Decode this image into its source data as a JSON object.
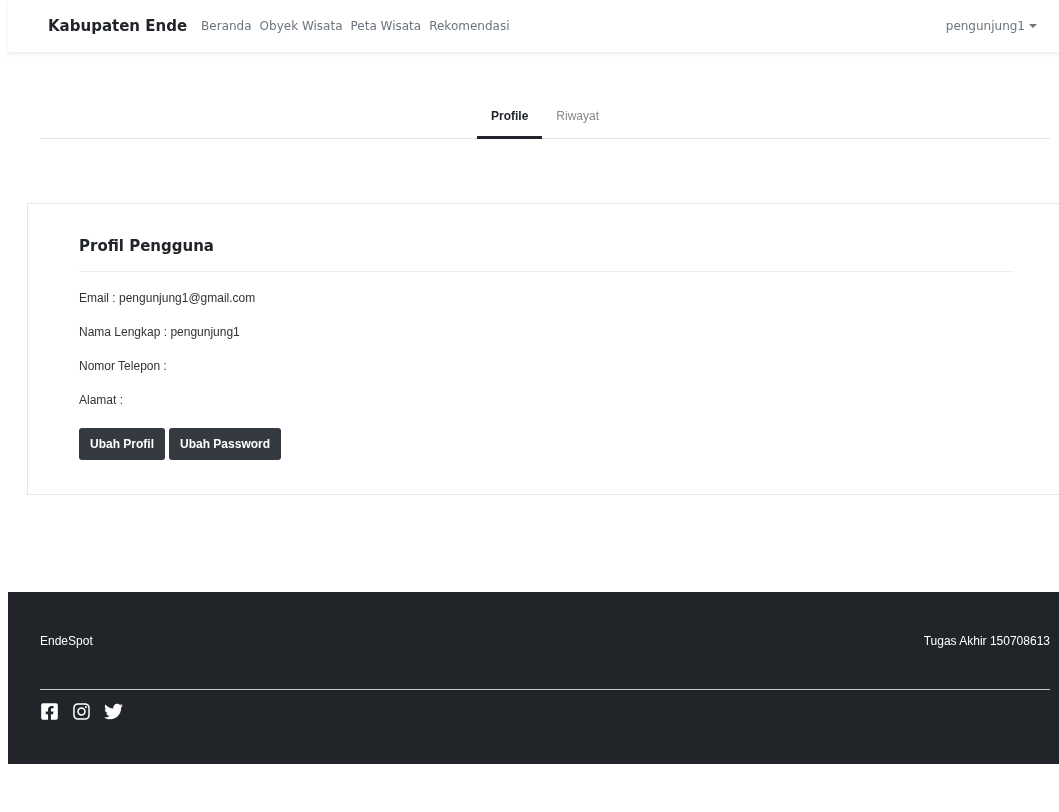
{
  "navbar": {
    "brand": "Kabupaten Ende",
    "links": [
      "Beranda",
      "Obyek Wisata",
      "Peta Wisata",
      "Rekomendasi"
    ],
    "user_menu": "pengunjung1"
  },
  "tabs": [
    {
      "label": "Profile",
      "selected": true
    },
    {
      "label": "Riwayat",
      "selected": false
    }
  ],
  "profile": {
    "title": "Profil Pengguna",
    "fields": [
      "Email : pengunjung1@gmail.com",
      "Nama Lengkap : pengunjung1",
      "Nomor Telepon :",
      "Alamat :"
    ],
    "buttons": [
      "Ubah Profil",
      "Ubah Password"
    ]
  },
  "footer": {
    "left": "EndeSpot",
    "right": "Tugas Akhir 150708613",
    "social": [
      {
        "kind": "facebook"
      },
      {
        "kind": "instagram"
      },
      {
        "kind": "twitter"
      }
    ]
  }
}
